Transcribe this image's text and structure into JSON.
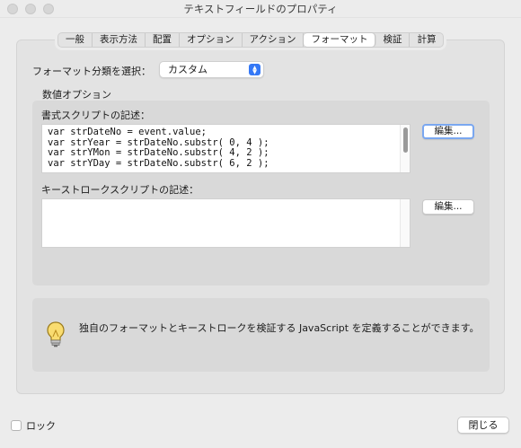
{
  "window": {
    "title": "テキストフィールドのプロパティ"
  },
  "tabs": [
    {
      "label": "一般",
      "active": false
    },
    {
      "label": "表示方法",
      "active": false
    },
    {
      "label": "配置",
      "active": false
    },
    {
      "label": "オプション",
      "active": false
    },
    {
      "label": "アクション",
      "active": false
    },
    {
      "label": "フォーマット",
      "active": true
    },
    {
      "label": "検証",
      "active": false
    },
    {
      "label": "計算",
      "active": false
    }
  ],
  "format": {
    "select_label": "フォーマット分類を選択：",
    "select_value": "カスタム"
  },
  "options": {
    "group_title": "数値オプション",
    "format_script_label": "書式スクリプトの記述：",
    "format_script_lines": [
      "var strDateNo = event.value;",
      "var strYear = strDateNo.substr( 0, 4 );",
      "var strYMon = strDateNo.substr( 4, 2 );",
      "var strYDay = strDateNo.substr( 6, 2 );"
    ],
    "edit_button_1": "編集...",
    "keystroke_script_label": "キーストロークスクリプトの記述：",
    "edit_button_2": "編集..."
  },
  "info": {
    "text": "独自のフォーマットとキーストロークを検証する JavaScript を定義することができます。",
    "icon": "lightbulb-icon"
  },
  "footer": {
    "lock_label": "ロック",
    "lock_checked": false,
    "close_label": "閉じる"
  },
  "colors": {
    "accent": "#3478f6",
    "focus_ring": "#7aa7f0"
  }
}
